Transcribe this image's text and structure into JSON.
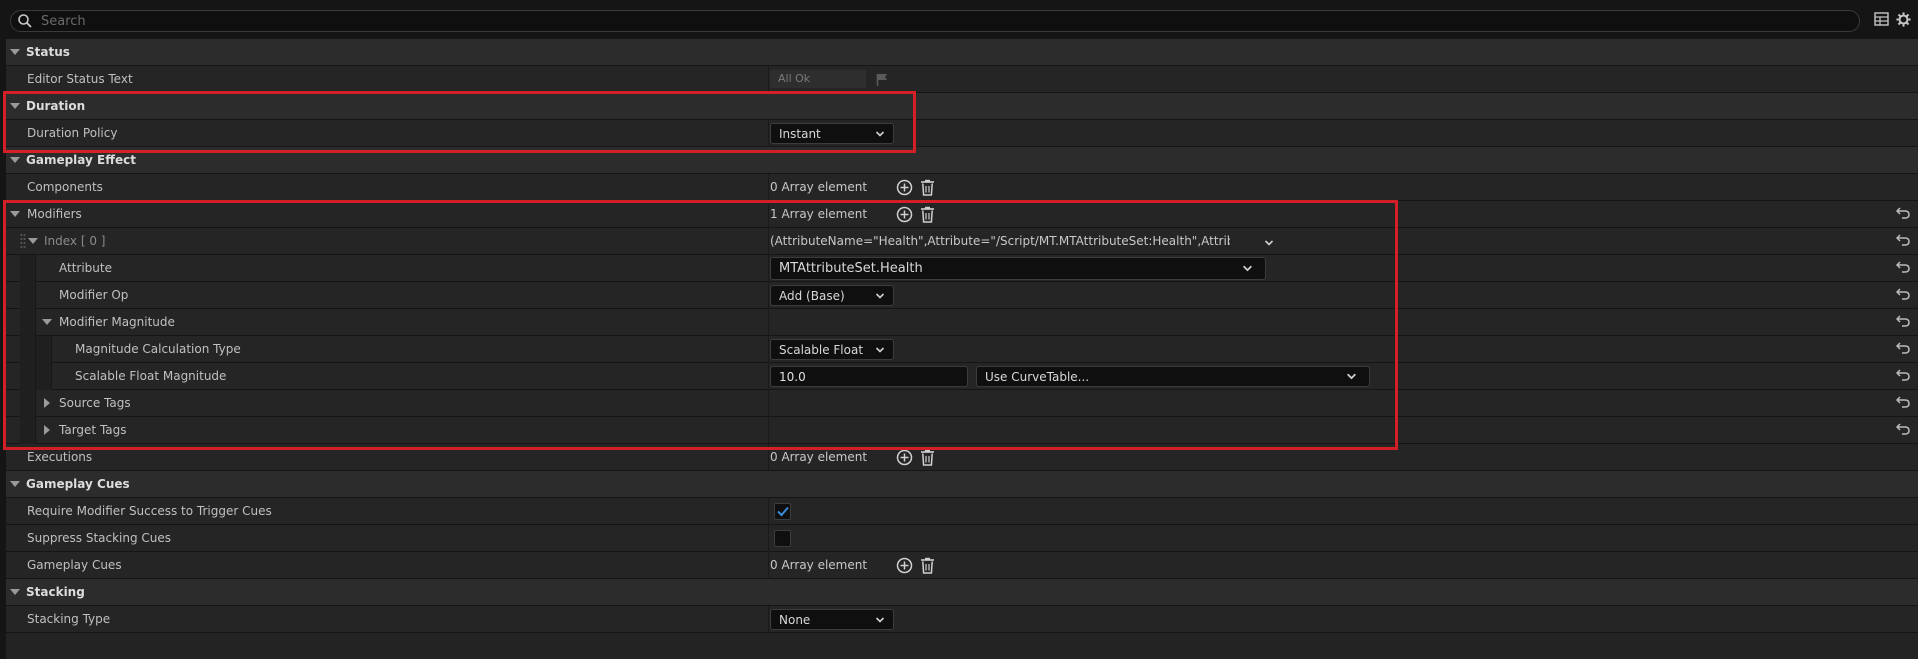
{
  "search": {
    "placeholder": "Search"
  },
  "icons": {
    "search": "search-icon",
    "table_view": "table-view-icon",
    "settings": "gear-icon",
    "add": "plus-circle-icon",
    "delete": "trash-icon",
    "reset": "reset-arrow-icon",
    "expand": "triangle-down-icon",
    "collapsed": "triangle-right-icon",
    "dropdown": "chevron-down-icon",
    "flag": "flag-icon",
    "check": "checkmark-icon"
  },
  "colors": {
    "highlight": "#d31f26",
    "checkbox_check": "#3a8ad6"
  },
  "status": {
    "header": "Status",
    "editor_status_text": {
      "label": "Editor Status Text",
      "value": "All Ok"
    }
  },
  "duration": {
    "header": "Duration",
    "duration_policy": {
      "label": "Duration Policy",
      "value": "Instant"
    }
  },
  "gameplay_effect": {
    "header": "Gameplay Effect",
    "components": {
      "label": "Components",
      "value": "0 Array element"
    },
    "modifiers": {
      "label": "Modifiers",
      "value": "1 Array element"
    },
    "index0": {
      "label": "Index [ 0 ]",
      "value": "(AttributeName=\"Health\",Attribute=\"/Script/MT.MTAttributeSet:Health\",AttributeOwner=\"/S"
    },
    "attribute": {
      "label": "Attribute",
      "value": "MTAttributeSet.Health"
    },
    "modifier_op": {
      "label": "Modifier Op",
      "value": "Add (Base)"
    },
    "modifier_magnitude": {
      "label": "Modifier Magnitude"
    },
    "magnitude_calc_type": {
      "label": "Magnitude Calculation Type",
      "value": "Scalable Float"
    },
    "scalable_float_magnitude": {
      "label": "Scalable Float Magnitude",
      "value": "10.0",
      "curve": "Use CurveTable..."
    },
    "source_tags": {
      "label": "Source Tags"
    },
    "target_tags": {
      "label": "Target Tags"
    },
    "executions": {
      "label": "Executions",
      "value": "0 Array element"
    }
  },
  "gameplay_cues": {
    "header": "Gameplay Cues",
    "require_modifier_success": {
      "label": "Require Modifier Success to Trigger Cues",
      "checked": true
    },
    "suppress_stacking": {
      "label": "Suppress Stacking Cues",
      "checked": false
    },
    "cues": {
      "label": "Gameplay Cues",
      "value": "0 Array element"
    }
  },
  "stacking": {
    "header": "Stacking",
    "stacking_type": {
      "label": "Stacking Type",
      "value": "None"
    }
  }
}
